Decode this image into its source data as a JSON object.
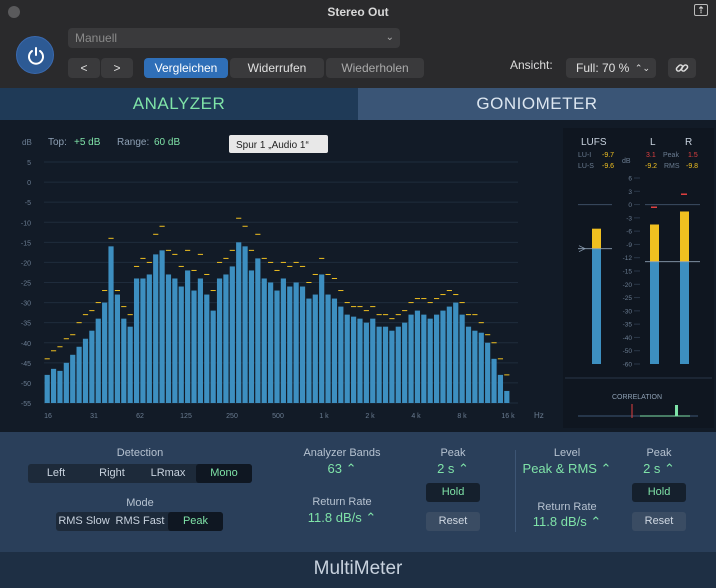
{
  "window": {
    "title": "Stereo Out"
  },
  "toolbar": {
    "preset_value": "Manuell",
    "back_label": "<",
    "forward_label": ">",
    "compare_label": "Vergleichen",
    "undo_label": "Widerrufen",
    "redo_label": "Wiederholen",
    "view_label": "Ansicht:",
    "view_value": "Full: 70 %",
    "view_arrows": "⌃⌄"
  },
  "tabs": [
    {
      "label": "ANALYZER",
      "active": true
    },
    {
      "label": "GONIOMETER",
      "active": false
    }
  ],
  "analyzer": {
    "db_unit": "dB",
    "top_label": "Top:",
    "top_value": "+5 dB",
    "range_label": "Range:",
    "range_value": "60 dB",
    "track_tooltip": "Spur 1 „Audio 1“",
    "hz_unit": "Hz"
  },
  "chart_data": {
    "type": "bar",
    "ylabel": "dB",
    "ylim": [
      -55,
      5
    ],
    "yticks": [
      "5",
      "0",
      "-5",
      "-10",
      "-15",
      "-20",
      "-25",
      "-30",
      "-35",
      "-40",
      "-45",
      "-50",
      "-55"
    ],
    "xticks": [
      "16",
      "31",
      "62",
      "125",
      "250",
      "500",
      "1 k",
      "2 k",
      "4 k",
      "8 k",
      "16 k"
    ],
    "xunit": "Hz",
    "bands": 63,
    "values": [
      -48,
      -46.5,
      -47,
      -45,
      -43,
      -41,
      -39,
      -37,
      -34,
      -30,
      -16,
      -28,
      -34,
      -36,
      -24,
      -24,
      -23,
      -18,
      -17,
      -23,
      -24,
      -26,
      -22,
      -27,
      -24,
      -28,
      -32,
      -24,
      -23,
      -21,
      -15,
      -16,
      -22,
      -19,
      -24,
      -25,
      -27,
      -24,
      -26,
      -25,
      -26,
      -29,
      -28,
      -23,
      -28,
      -29,
      -31,
      -33,
      -33.5,
      -34,
      -35,
      -34,
      -36,
      -36,
      -37,
      -36,
      -35,
      -33,
      -32,
      -33,
      -34,
      -33,
      -32,
      -31,
      -30,
      -33,
      -36,
      -37,
      -37.5,
      -40,
      -44,
      -48,
      -52
    ],
    "peak_holds": [
      -44,
      -42,
      -41,
      -39,
      -38,
      -35,
      -33,
      -32,
      -30,
      -27,
      -14,
      -27,
      -31,
      -33,
      -21,
      -19,
      -20,
      -13,
      -11,
      -17,
      -18,
      -21,
      -17,
      -22,
      -18,
      -23,
      -27,
      -20,
      -19,
      -17,
      -9,
      -11,
      -17,
      -13,
      -19,
      -20,
      -22,
      -20,
      -21,
      -20,
      -21,
      -25,
      -23,
      -19,
      -23,
      -24,
      -27,
      -30,
      -31,
      -31,
      -32,
      -31,
      -33,
      -33,
      -34,
      -33,
      -32,
      -30,
      -29,
      -29,
      -30,
      -29,
      -28,
      -27,
      -28,
      -30,
      -33,
      -33,
      -35,
      -38,
      -40,
      -44,
      -48
    ]
  },
  "lufs": {
    "title": "LUFS",
    "lu_i_label": "LU-I",
    "lu_i_value": "-9.7",
    "lu_s_label": "LU-S",
    "lu_s_value": "-9.6",
    "db_unit": "dB",
    "level_fraction": 0.62,
    "scale": [
      "6",
      "3",
      "0",
      "-3",
      "-6",
      "-9",
      "-12",
      "-15",
      "-20",
      "-25",
      "-30",
      "-35",
      "-40",
      "-50",
      "-60"
    ]
  },
  "lr_meter": {
    "l_label": "L",
    "r_label": "R",
    "l_peak": "3.1",
    "r_peak": "1.5",
    "l_rms": "-9.2",
    "r_rms": "-9.8",
    "peak_label": "Peak",
    "rms_label": "RMS",
    "l_peak_fraction": 0.75,
    "r_peak_fraction": 0.82,
    "l_rms_fraction": 0.55,
    "r_rms_fraction": 0.55
  },
  "correlation": {
    "label": "CORRELATION"
  },
  "controls": {
    "detection_label": "Detection",
    "detection_options": [
      "Left",
      "Right",
      "LRmax",
      "Mono"
    ],
    "detection_selected": "Mono",
    "mode_label": "Mode",
    "mode_options": [
      "RMS Slow",
      "RMS Fast",
      "Peak"
    ],
    "mode_selected": "Peak",
    "analyzer_bands_label": "Analyzer Bands",
    "analyzer_bands_value": "63 ⌃",
    "return_rate_label": "Return Rate",
    "return_rate_value": "11.8 dB/s ⌃",
    "peak_label": "Peak",
    "peak_value": "2 s ⌃",
    "hold_label": "Hold",
    "reset_label": "Reset",
    "level_label": "Level",
    "level_value": "Peak & RMS ⌃",
    "level_return_rate_label": "Return Rate",
    "level_return_rate_value": "11.8 dB/s ⌃",
    "level_peak_label": "Peak",
    "level_peak_value": "2 s ⌃",
    "level_hold_label": "Hold",
    "level_reset_label": "Reset"
  },
  "footer": {
    "title": "MultiMeter"
  },
  "colors": {
    "accent_green": "#7fe3a8",
    "bar_blue": "#3d8fc0",
    "peak_yellow": "#f0c020",
    "peak_red": "#e04040",
    "compare_blue": "#2f6fb8"
  }
}
